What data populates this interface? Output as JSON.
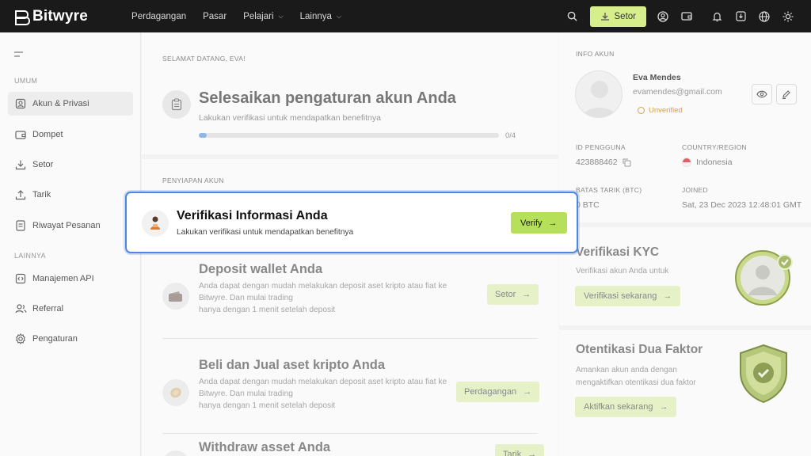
{
  "brand": {
    "name": "Bitwyre"
  },
  "topnav": {
    "items": [
      {
        "label": "Perdagangan"
      },
      {
        "label": "Pasar"
      },
      {
        "label": "Pelajari",
        "dropdown": true
      },
      {
        "label": "Lainnya",
        "dropdown": true
      }
    ],
    "setor_label": "Setor",
    "icons": [
      "search-icon",
      "download-icon",
      "user-circle-icon",
      "wallet-icon",
      "bell-icon",
      "import-icon",
      "globe-icon",
      "sun-icon"
    ]
  },
  "sidebar": {
    "section1": "UMUM",
    "items1": [
      {
        "label": "Akun & Privasi",
        "icon": "user-icon",
        "active": true
      },
      {
        "label": "Dompet",
        "icon": "wallet-icon"
      },
      {
        "label": "Setor",
        "icon": "download-icon"
      },
      {
        "label": "Tarik",
        "icon": "upload-icon"
      },
      {
        "label": "Riwayat Pesanan",
        "icon": "document-icon"
      }
    ],
    "section2": "LAINNYA",
    "items2": [
      {
        "label": "Manajemen API",
        "icon": "code-icon"
      },
      {
        "label": "Referral",
        "icon": "users-icon"
      },
      {
        "label": "Pengaturan",
        "icon": "gear-icon"
      }
    ]
  },
  "main": {
    "welcome": "SELAMAT DATANG, EVA!",
    "setup_title": "Selesaikan pengaturan akun Anda",
    "setup_sub": "Lakukan verifikasi untuk mendapatkan benefitnya",
    "progress_text": "0/4",
    "progress_fraction": 0.0,
    "prep_label": "PENYIAPAN AKUN",
    "focus_step": {
      "title": "Verifikasi Informasi Anda",
      "desc": "Lakukan verifikasi untuk mendapatkan benefitnya",
      "button": "Verify"
    },
    "steps": [
      {
        "title": "Deposit wallet Anda",
        "desc1": "Anda dapat dengan mudah melakukan deposit aset kripto atau fiat ke Bitwyre. Dan mulai trading",
        "desc2": "hanya dengan 1 menit setelah deposit",
        "button": "Setor"
      },
      {
        "title": "Beli dan Jual aset kripto Anda",
        "desc1": "Anda dapat dengan mudah melakukan deposit aset kripto atau fiat ke Bitwyre. Dan mulai trading",
        "desc2": "hanya dengan 1 menit setelah deposit",
        "button": "Perdagangan"
      },
      {
        "title": "Withdraw asset Anda",
        "button": "Tarik"
      }
    ]
  },
  "account": {
    "label": "INFO AKUN",
    "name": "Eva Mendes",
    "email": "evamendes@gmail.com",
    "status": "Unverified",
    "id_label": "ID PENGGUNA",
    "id_value": "423888462",
    "country_label": "COUNTRY/REGION",
    "country_value": "Indonesia",
    "limit_label": "BATAS TARIK (BTC)",
    "limit_value": "0 BTC",
    "joined_label": "JOINED",
    "joined_value": "Sat, 23 Dec 2023 12:48:01 GMT"
  },
  "kyc": {
    "title": "Verifikasi KYC",
    "desc": "Verifikasi akun Anda untuk",
    "button": "Verifikasi sekarang"
  },
  "tfa": {
    "title": "Otentikasi Dua Faktor",
    "desc": "Amankan akun anda dengan mengaktifkan otentikasi dua faktor",
    "button": "Aktifkan sekarang"
  },
  "colors": {
    "accent": "#b6e05a",
    "topbar": "#1a1a1a",
    "focus_border": "#4f86e0",
    "unverified": "#d6a24a"
  }
}
